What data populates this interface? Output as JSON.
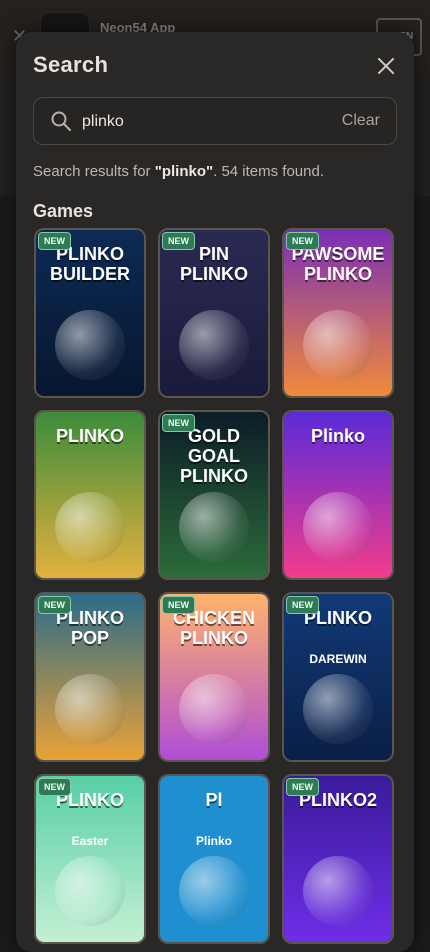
{
  "banner": {
    "app_name": "Neon54 App",
    "open_label": "OPEN"
  },
  "modal": {
    "title": "Search",
    "search": {
      "value": "plinko",
      "placeholder": "",
      "clear_label": "Clear"
    },
    "results": {
      "prefix": "Search results for ",
      "query": "\"plinko\"",
      "suffix": ". 54 items found."
    },
    "section_title": "Games"
  },
  "games": [
    {
      "title": "PLINKO BUILDER",
      "badge": "NEW",
      "colors": [
        "#0c2b54",
        "#08162f"
      ]
    },
    {
      "title": "PIN PLINKO",
      "badge": "NEW",
      "colors": [
        "#2b2a52",
        "#1a1a3a"
      ]
    },
    {
      "title": "PAWSOME PLINKO",
      "badge": "NEW",
      "colors": [
        "#7a2fb5",
        "#f18a3a"
      ]
    },
    {
      "title": "PLINKO",
      "badge": "",
      "colors": [
        "#3b8c3c",
        "#e3b13e"
      ]
    },
    {
      "title": "GOLD GOAL PLINKO",
      "badge": "NEW",
      "colors": [
        "#0c1c28",
        "#2c6b3a"
      ]
    },
    {
      "title": "Plinko",
      "badge": "",
      "colors": [
        "#5a2bd6",
        "#f23c8c"
      ]
    },
    {
      "title": "PLINKO POP",
      "badge": "NEW",
      "colors": [
        "#2c6b8a",
        "#e9a236"
      ]
    },
    {
      "title": "CHICKEN PLINKO",
      "badge": "NEW",
      "colors": [
        "#ffb36b",
        "#b04dd6"
      ]
    },
    {
      "title": "PLINKO",
      "subtitle": "DAREWIN",
      "badge": "NEW",
      "colors": [
        "#123a77",
        "#0a1f46"
      ]
    },
    {
      "title": "PLINKO",
      "subtitle": "Easter",
      "badge": "NEW",
      "colors": [
        "#57cfa6",
        "#c4f0d4"
      ]
    },
    {
      "title": "Pl",
      "subtitle": "Plinko",
      "badge": "",
      "colors": [
        "#1f8fcf",
        "#1f8fcf"
      ]
    },
    {
      "title": "PLINKO2",
      "badge": "NEW",
      "colors": [
        "#3a1a9a",
        "#6e2ee8"
      ]
    }
  ]
}
